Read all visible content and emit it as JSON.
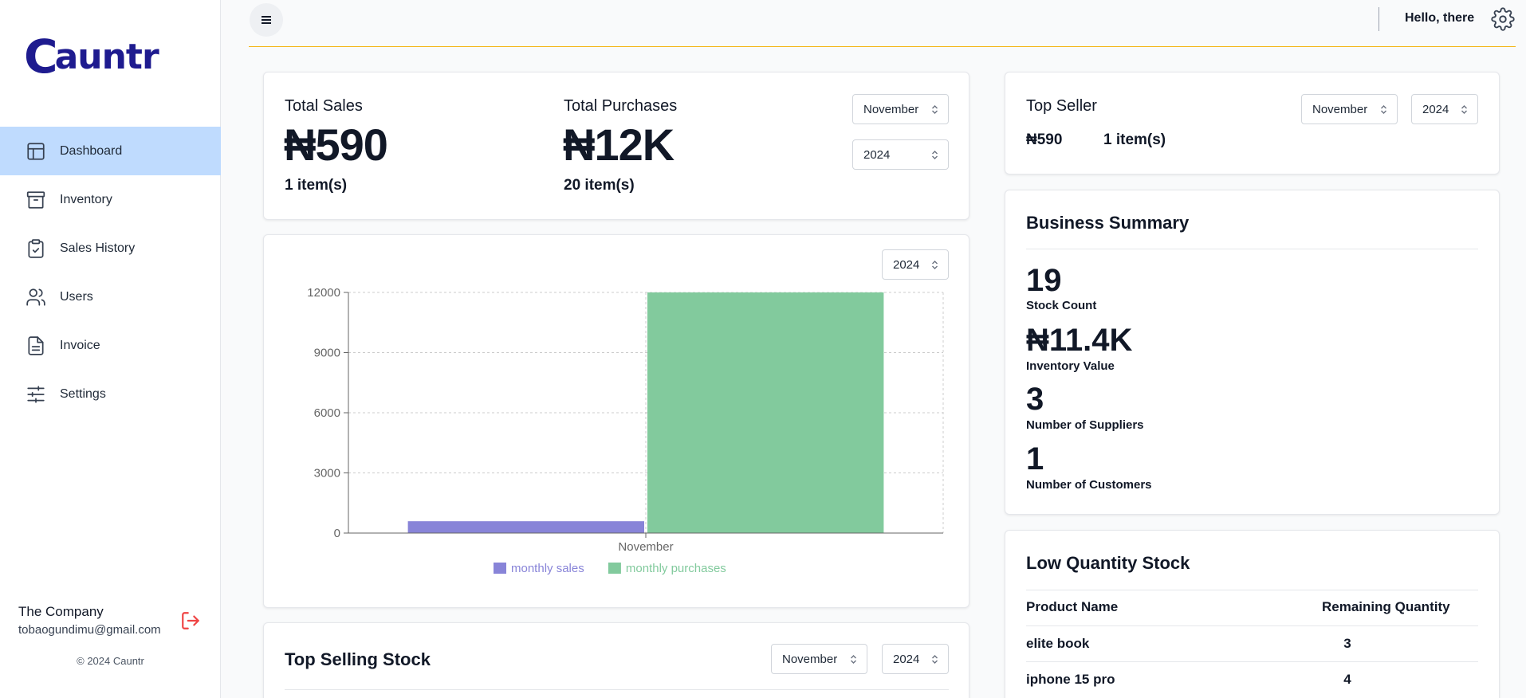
{
  "brand": {
    "logo_letter": "C",
    "logo_rest": "auntr",
    "accent": "#f5b517",
    "primary": "#1e1b8f"
  },
  "sidebar": {
    "items": [
      {
        "label": "Dashboard",
        "icon": "layout-icon",
        "active": true
      },
      {
        "label": "Inventory",
        "icon": "archive-icon",
        "active": false
      },
      {
        "label": "Sales History",
        "icon": "clipboard-check-icon",
        "active": false
      },
      {
        "label": "Users",
        "icon": "users-icon",
        "active": false
      },
      {
        "label": "Invoice",
        "icon": "file-text-icon",
        "active": false
      },
      {
        "label": "Settings",
        "icon": "sliders-icon",
        "active": false
      }
    ],
    "company_name": "The Company",
    "company_email": "tobaogundimu@gmail.com",
    "copyright": "© 2024 Cauntr"
  },
  "topbar": {
    "greeting": "Hello, there",
    "accent_line": "#f5b517"
  },
  "totals": {
    "sales_label": "Total Sales",
    "sales_value": "₦590",
    "sales_items": "1 item(s)",
    "purchases_label": "Total Purchases",
    "purchases_value": "₦12K",
    "purchases_items": "20 item(s)",
    "month_select": "November",
    "year_select": "2024"
  },
  "chart_card": {
    "year_select": "2024"
  },
  "chart_data": {
    "type": "bar",
    "categories": [
      "November"
    ],
    "series": [
      {
        "name": "monthly sales",
        "values": [
          590
        ],
        "color": "#8884d8"
      },
      {
        "name": "monthly purchases",
        "values": [
          12000
        ],
        "color": "#82ca9d"
      }
    ],
    "yticks": [
      "0",
      "3000",
      "6000",
      "9000",
      "12000"
    ],
    "ylim": [
      0,
      12000
    ],
    "grid": true,
    "legend": "bottom"
  },
  "top_selling": {
    "title": "Top Selling Stock",
    "month_select": "November",
    "year_select": "2024"
  },
  "top_seller": {
    "title": "Top Seller",
    "amount": "₦590",
    "items": "1 item(s)",
    "month_select": "November",
    "year_select": "2024"
  },
  "business_summary": {
    "title": "Business Summary",
    "stats": [
      {
        "value": "19",
        "label": "Stock Count"
      },
      {
        "value": "₦11.4K",
        "label": "Inventory Value"
      },
      {
        "value": "3",
        "label": "Number of Suppliers"
      },
      {
        "value": "1",
        "label": "Number of Customers"
      }
    ]
  },
  "low_stock": {
    "title": "Low Quantity Stock",
    "headers": [
      "Product Name",
      "Remaining Quantity"
    ],
    "rows": [
      {
        "name": "elite book",
        "qty": "3"
      },
      {
        "name": "iphone 15 pro",
        "qty": "4"
      }
    ]
  }
}
